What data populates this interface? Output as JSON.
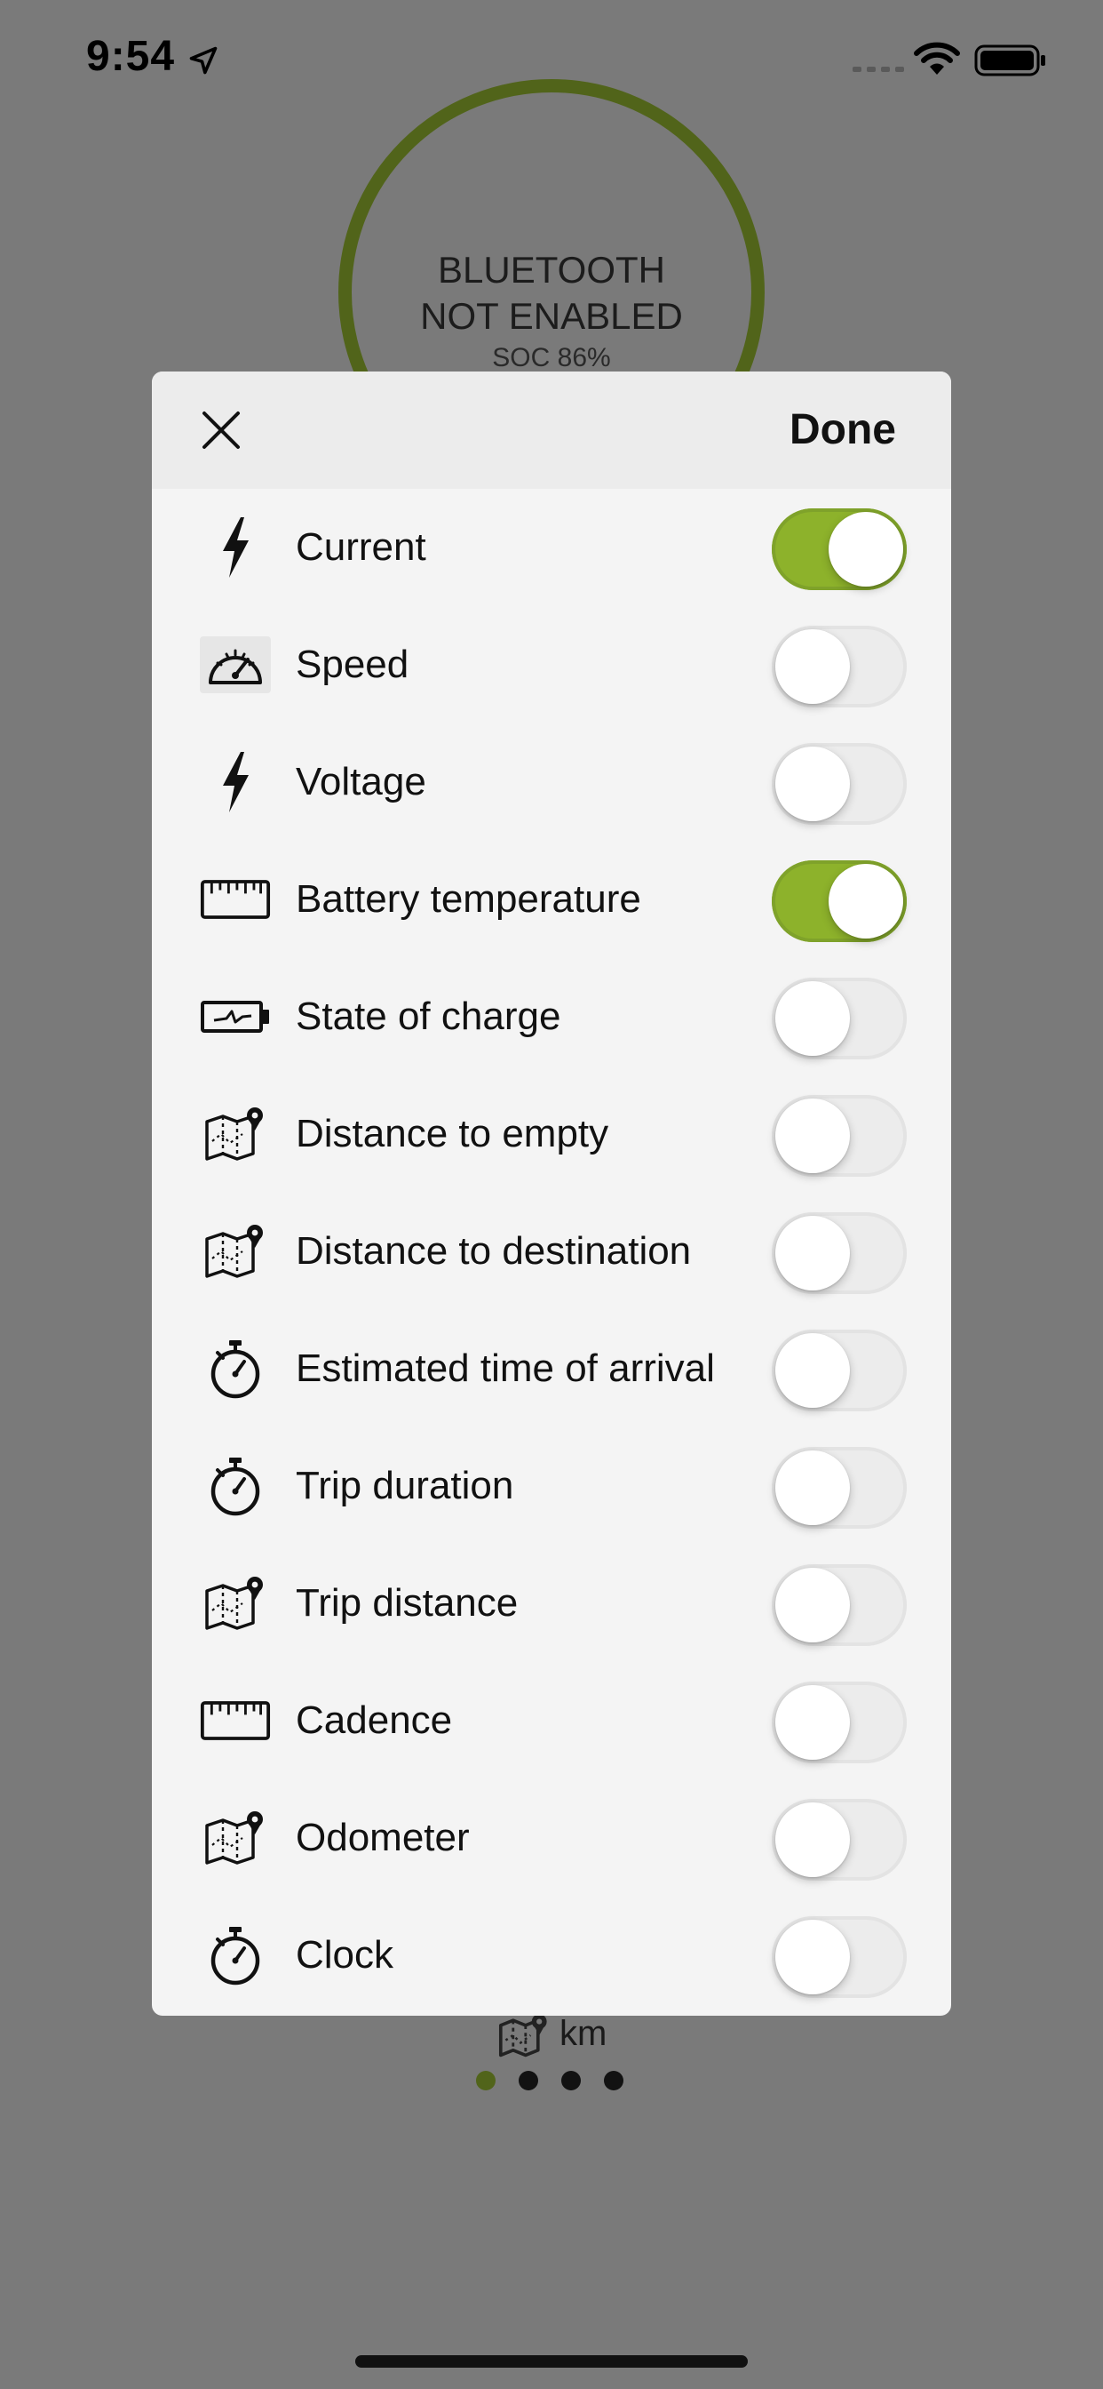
{
  "status_bar": {
    "time": "9:54",
    "icons": [
      "location-arrow-icon",
      "cellular-signal-icon",
      "wifi-icon",
      "battery-icon"
    ]
  },
  "gauge": {
    "title_line1": "BLUETOOTH",
    "title_line2": "NOT ENABLED",
    "soc": "SOC 86%",
    "ring_color": "#51641a"
  },
  "modal": {
    "close_icon": "close-icon",
    "done_label": "Done",
    "toggle_on_color": "#8db22b",
    "items": [
      {
        "label": "Current",
        "icon": "lightning-bolt-icon",
        "enabled": true
      },
      {
        "label": "Speed",
        "icon": "speedometer-icon",
        "enabled": false
      },
      {
        "label": "Voltage",
        "icon": "lightning-bolt-icon",
        "enabled": false
      },
      {
        "label": "Battery temperature",
        "icon": "ruler-icon",
        "enabled": true
      },
      {
        "label": "State of charge",
        "icon": "battery-charge-icon",
        "enabled": false
      },
      {
        "label": "Distance to empty",
        "icon": "map-pin-icon",
        "enabled": false
      },
      {
        "label": "Distance to destination",
        "icon": "map-pin-icon",
        "enabled": false
      },
      {
        "label": "Estimated time of arrival",
        "icon": "stopwatch-icon",
        "enabled": false
      },
      {
        "label": "Trip duration",
        "icon": "stopwatch-icon",
        "enabled": false
      },
      {
        "label": "Trip distance",
        "icon": "map-pin-icon",
        "enabled": false
      },
      {
        "label": "Cadence",
        "icon": "ruler-icon",
        "enabled": false
      },
      {
        "label": "Odometer",
        "icon": "map-pin-icon",
        "enabled": false
      },
      {
        "label": "Clock",
        "icon": "stopwatch-icon",
        "enabled": false
      }
    ]
  },
  "footer": {
    "unit": "km",
    "unit_icon": "map-pin-icon",
    "page_count": 4,
    "active_page": 1
  }
}
